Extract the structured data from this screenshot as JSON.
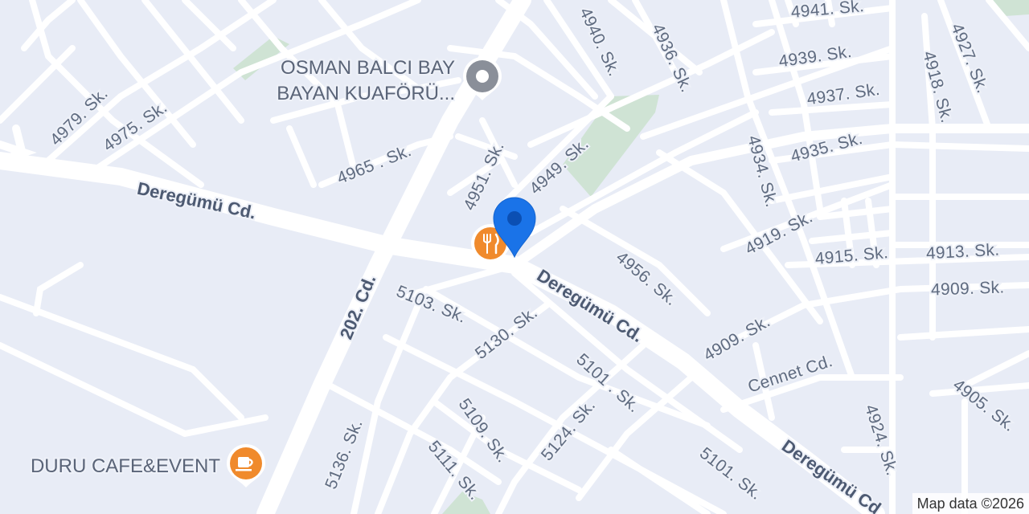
{
  "map": {
    "attribution": "Map data ©2026",
    "colors": {
      "background": "#e8ecf6",
      "road": "#ffffff",
      "park": "#cfe3d4",
      "pin": "#1a73e8",
      "poi_orange": "#f08a2c",
      "poi_gray": "#8a8f99"
    }
  },
  "pois": {
    "salon_line1": "OSMAN BALCI BAY",
    "salon_line2": "BAYAN KUAFÖRÜ...",
    "salon_icon": "pin-gray-icon",
    "cafe": "DURU CAFE&EVENT",
    "cafe_icon": "coffee-icon",
    "restaurant_icon": "restaurant-icon"
  },
  "location_pin_icon": "location-pin-icon",
  "streets": {
    "s4941": "4941. Sk.",
    "s4940": "4940. Sk.",
    "s4936": "4936. Sk.",
    "s4927": "4927. Sk.",
    "s4918": "4918. Sk.",
    "s4939": "4939. Sk.",
    "s4937": "4937. Sk.",
    "s4935": "4935. Sk.",
    "s4934": "4934. Sk.",
    "s4979": "4979. Sk.",
    "s4975": "4975. Sk.",
    "s4965": "4965 . Sk.",
    "s4951": "4951. Sk.",
    "s4949": "4949. Sk.",
    "s4919": "4919. Sk.",
    "s4915": "4915. Sk.",
    "s4913": "4913. Sk.",
    "s4909a": "4909. Sk.",
    "s4909b": "4909. Sk.",
    "s4956": "4956. Sk.",
    "deregumu1": "Deregümü Cd.",
    "deregumu2": "Deregümü Cd.",
    "deregumu3": "Deregümü Cd",
    "c202": "202. Cd.",
    "s5103": "5103. Sk.",
    "s5130": "5130. Sk.",
    "s5101a": "5101 . Sk.",
    "s5101b": "5101. Sk.",
    "cennet": "Cennet Cd.",
    "s4905": "4905. Sk.",
    "s4924": "4924. Sk.",
    "s5109": "5109. Sk.",
    "s5124": "5124. Sk.",
    "s5111": "5111. Sk.",
    "s5136": "5136. Sk."
  }
}
